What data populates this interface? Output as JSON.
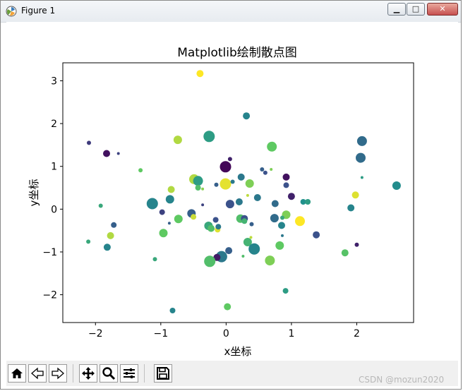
{
  "window": {
    "title": "Figure 1",
    "minimize_label": "▁",
    "maximize_label": "□",
    "close_label": "✕"
  },
  "toolbar": {
    "buttons": [
      {
        "icon": "home-icon"
      },
      {
        "icon": "back-arrow-icon"
      },
      {
        "icon": "forward-arrow-icon"
      },
      {
        "icon": "pan-icon"
      },
      {
        "icon": "zoom-icon"
      },
      {
        "icon": "configure-subplots-icon"
      },
      {
        "icon": "save-icon"
      }
    ]
  },
  "watermark": "CSDN @mozun2020",
  "chart_data": {
    "type": "scatter",
    "title": "Matplotlib绘制散点图",
    "xlabel": "x坐标",
    "ylabel": "y坐标",
    "xlim": [
      -2.5,
      2.87
    ],
    "ylim": [
      -2.65,
      3.42
    ],
    "xticks": [
      -2,
      -1,
      0,
      1,
      2
    ],
    "xtick_labels": [
      "−2",
      "−1",
      "0",
      "1",
      "2"
    ],
    "yticks": [
      -2,
      -1,
      0,
      1,
      2,
      3
    ],
    "ytick_labels": [
      "−2",
      "−1",
      "0",
      "1",
      "2",
      "3"
    ],
    "grid": false,
    "colormap": "viridis",
    "colormap_stops": [
      "#440154",
      "#3b528b",
      "#21918c",
      "#5ec962",
      "#fde725"
    ],
    "points": [
      {
        "x": -0.4,
        "y": 3.17,
        "s": 5,
        "c": 1.0
      },
      {
        "x": 0.31,
        "y": 2.18,
        "s": 5,
        "c": 0.45
      },
      {
        "x": -0.26,
        "y": 1.7,
        "s": 8,
        "c": 0.55
      },
      {
        "x": -0.74,
        "y": 1.62,
        "s": 6,
        "c": 0.88
      },
      {
        "x": 0.7,
        "y": 1.46,
        "s": 7,
        "c": 0.75
      },
      {
        "x": 2.08,
        "y": 1.59,
        "s": 7,
        "c": 0.35
      },
      {
        "x": 2.06,
        "y": 1.2,
        "s": 7,
        "c": 0.35
      },
      {
        "x": -2.1,
        "y": 1.55,
        "s": 3,
        "c": 0.18
      },
      {
        "x": -1.83,
        "y": 1.3,
        "s": 5,
        "c": 0.05
      },
      {
        "x": -1.65,
        "y": 1.3,
        "s": 2,
        "c": 0.2
      },
      {
        "x": 0.06,
        "y": 1.17,
        "s": 3,
        "c": 0.1
      },
      {
        "x": -0.01,
        "y": 0.99,
        "s": 8,
        "c": 0.02
      },
      {
        "x": -1.31,
        "y": 0.91,
        "s": 3,
        "c": 0.75
      },
      {
        "x": 0.55,
        "y": 0.93,
        "s": 3,
        "c": 0.3
      },
      {
        "x": 0.69,
        "y": 0.93,
        "s": 2,
        "c": 0.8
      },
      {
        "x": 0.6,
        "y": 0.85,
        "s": 3,
        "c": 0.25
      },
      {
        "x": 0.92,
        "y": 0.75,
        "s": 5,
        "c": 0.05
      },
      {
        "x": 0.23,
        "y": 0.75,
        "s": 5,
        "c": 0.4
      },
      {
        "x": -0.49,
        "y": 0.7,
        "s": 7,
        "c": 0.88
      },
      {
        "x": -0.43,
        "y": 0.66,
        "s": 7,
        "c": 0.55
      },
      {
        "x": 0.36,
        "y": 0.6,
        "s": 6,
        "c": 0.8
      },
      {
        "x": -0.15,
        "y": 0.57,
        "s": 3,
        "c": 0.3
      },
      {
        "x": -0.01,
        "y": 0.59,
        "s": 8,
        "c": 0.96
      },
      {
        "x": 0.1,
        "y": 0.64,
        "s": 3,
        "c": 0.4
      },
      {
        "x": 0.92,
        "y": 0.56,
        "s": 4,
        "c": 0.25
      },
      {
        "x": -0.84,
        "y": 0.46,
        "s": 5,
        "c": 0.88
      },
      {
        "x": -0.43,
        "y": 0.5,
        "s": 4,
        "c": 0.7
      },
      {
        "x": -0.36,
        "y": 0.47,
        "s": 2,
        "c": 0.82
      },
      {
        "x": 2.61,
        "y": 0.55,
        "s": 6,
        "c": 0.48
      },
      {
        "x": 1.98,
        "y": 0.33,
        "s": 5,
        "c": 0.95
      },
      {
        "x": 2.08,
        "y": 0.74,
        "s": 2,
        "c": 0.55
      },
      {
        "x": 1.0,
        "y": 0.3,
        "s": 5,
        "c": 0.1
      },
      {
        "x": 0.48,
        "y": 0.27,
        "s": 5,
        "c": 0.4
      },
      {
        "x": 0.33,
        "y": 0.32,
        "s": 2,
        "c": 0.9
      },
      {
        "x": -0.86,
        "y": 0.23,
        "s": 6,
        "c": 0.45
      },
      {
        "x": -1.13,
        "y": 0.13,
        "s": 8,
        "c": 0.45
      },
      {
        "x": 0.06,
        "y": 0.12,
        "s": 6,
        "c": 0.25
      },
      {
        "x": 0.2,
        "y": 0.17,
        "s": 5,
        "c": 0.4
      },
      {
        "x": 0.75,
        "y": 0.13,
        "s": 5,
        "c": 0.35
      },
      {
        "x": 1.18,
        "y": 0.17,
        "s": 4,
        "c": 0.5
      },
      {
        "x": 1.25,
        "y": 0.17,
        "s": 4,
        "c": 0.55
      },
      {
        "x": -1.92,
        "y": 0.08,
        "s": 3,
        "c": 0.6
      },
      {
        "x": -0.36,
        "y": 0.1,
        "s": 2,
        "c": 0.2
      },
      {
        "x": 1.91,
        "y": 0.03,
        "s": 5,
        "c": 0.45
      },
      {
        "x": -0.98,
        "y": -0.07,
        "s": 4,
        "c": 0.2
      },
      {
        "x": -0.53,
        "y": -0.1,
        "s": 6,
        "c": 0.3
      },
      {
        "x": -0.5,
        "y": -0.18,
        "s": 4,
        "c": 0.92
      },
      {
        "x": -0.73,
        "y": -0.23,
        "s": 6,
        "c": 0.75
      },
      {
        "x": 0.92,
        "y": -0.13,
        "s": 6,
        "c": 0.8
      },
      {
        "x": 0.74,
        "y": -0.21,
        "s": 6,
        "c": 0.35
      },
      {
        "x": 0.86,
        "y": -0.2,
        "s": 3,
        "c": 0.6
      },
      {
        "x": 0.22,
        "y": -0.22,
        "s": 6,
        "c": 0.7
      },
      {
        "x": 0.28,
        "y": -0.22,
        "s": 5,
        "c": 0.25
      },
      {
        "x": 0.28,
        "y": -0.28,
        "s": 4,
        "c": 0.65
      },
      {
        "x": -0.16,
        "y": -0.25,
        "s": 4,
        "c": 0.25
      },
      {
        "x": -0.27,
        "y": -0.39,
        "s": 6,
        "c": 0.6
      },
      {
        "x": -0.23,
        "y": -0.45,
        "s": 5,
        "c": 0.7
      },
      {
        "x": -0.13,
        "y": -0.48,
        "s": 4,
        "c": 0.95
      },
      {
        "x": -0.12,
        "y": -0.41,
        "s": 4,
        "c": 0.4
      },
      {
        "x": 1.13,
        "y": -0.28,
        "s": 7,
        "c": 1.0
      },
      {
        "x": 0.85,
        "y": -0.38,
        "s": 5,
        "c": 0.45
      },
      {
        "x": 0.39,
        "y": -0.35,
        "s": 3,
        "c": 0.3
      },
      {
        "x": 1.38,
        "y": -0.6,
        "s": 5,
        "c": 0.25
      },
      {
        "x": -1.72,
        "y": -0.37,
        "s": 4,
        "c": 0.3
      },
      {
        "x": -0.96,
        "y": -0.56,
        "s": 6,
        "c": 0.75
      },
      {
        "x": -1.77,
        "y": -0.62,
        "s": 5,
        "c": 0.88
      },
      {
        "x": -0.87,
        "y": -0.33,
        "s": 2,
        "c": 0.3
      },
      {
        "x": 0.86,
        "y": -0.62,
        "s": 2,
        "c": 0.4
      },
      {
        "x": 0.33,
        "y": -0.77,
        "s": 6,
        "c": 0.65
      },
      {
        "x": 0.38,
        "y": -0.66,
        "s": 2,
        "c": 0.9
      },
      {
        "x": 0.43,
        "y": -0.93,
        "s": 8,
        "c": 0.45
      },
      {
        "x": 0.82,
        "y": -0.85,
        "s": 6,
        "c": 0.75
      },
      {
        "x": -2.11,
        "y": -0.76,
        "s": 3,
        "c": 0.6
      },
      {
        "x": -1.82,
        "y": -0.89,
        "s": 5,
        "c": 0.45
      },
      {
        "x": 0.04,
        "y": -0.97,
        "s": 5,
        "c": 0.3
      },
      {
        "x": -0.07,
        "y": -1.11,
        "s": 8,
        "c": 0.4
      },
      {
        "x": -0.14,
        "y": -1.13,
        "s": 5,
        "c": 0.08
      },
      {
        "x": -0.25,
        "y": -1.22,
        "s": 8,
        "c": 0.7
      },
      {
        "x": 0.26,
        "y": -1.1,
        "s": 2,
        "c": 0.7
      },
      {
        "x": 0.67,
        "y": -1.2,
        "s": 7,
        "c": 0.8
      },
      {
        "x": -1.09,
        "y": -1.17,
        "s": 3,
        "c": 0.6
      },
      {
        "x": 1.82,
        "y": -1.02,
        "s": 5,
        "c": 0.72
      },
      {
        "x": 2.0,
        "y": -0.83,
        "s": 3,
        "c": 0.1
      },
      {
        "x": 0.91,
        "y": -1.91,
        "s": 4,
        "c": 0.55
      },
      {
        "x": -0.82,
        "y": -2.37,
        "s": 4,
        "c": 0.45
      },
      {
        "x": 0.02,
        "y": -2.28,
        "s": 5,
        "c": 0.75
      }
    ]
  }
}
